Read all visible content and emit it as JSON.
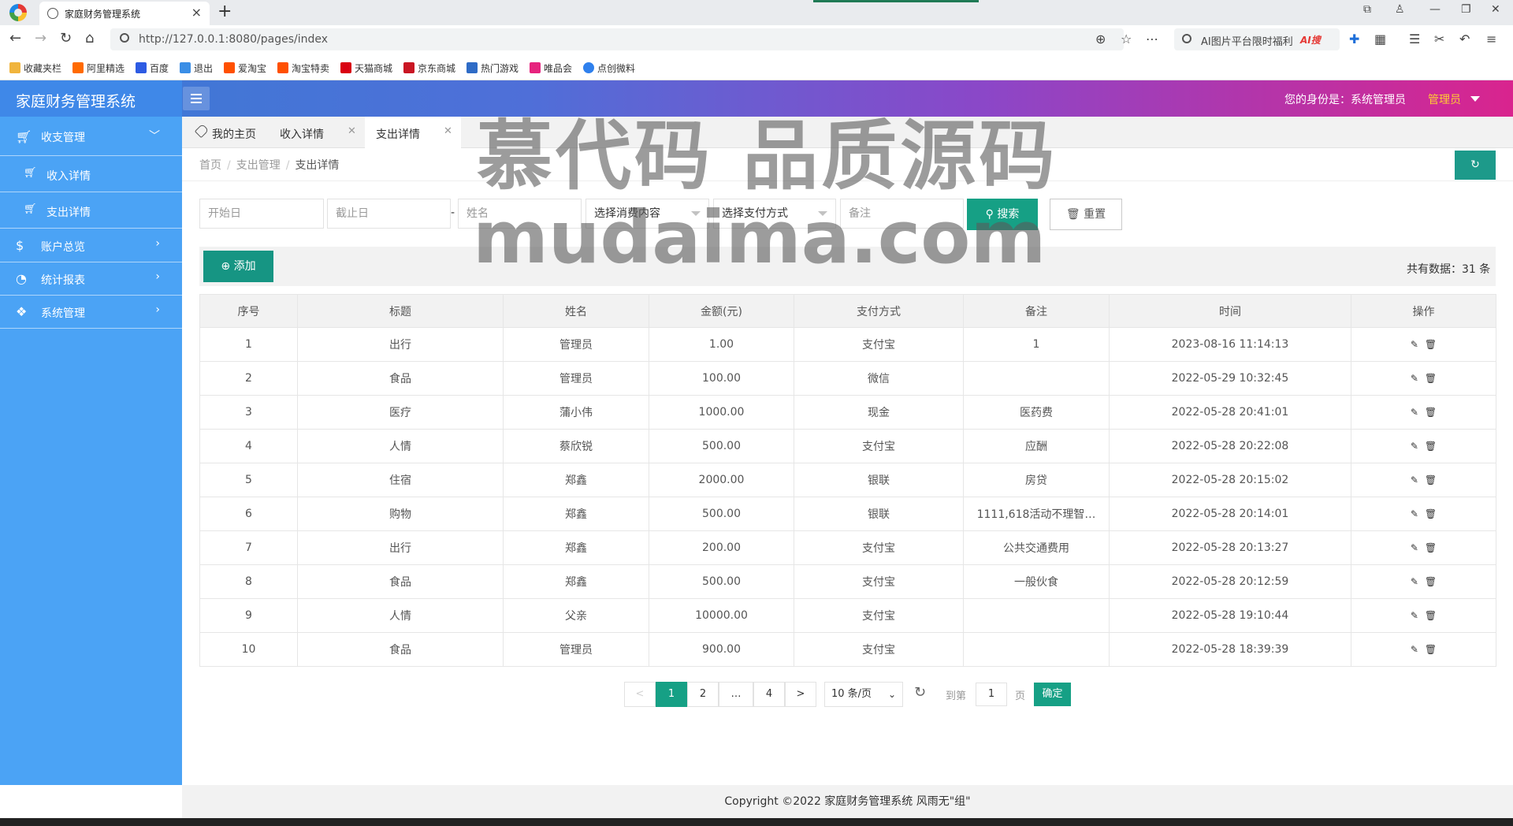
{
  "browser": {
    "tab_title": "家庭财务管理系统",
    "url": "http://127.0.0.1:8080/pages/index",
    "search_text": "AI图片平台限时福利",
    "search_hot": "AI搜",
    "bookmarks": [
      "收藏夹栏",
      "阿里精选",
      "百度",
      "退出",
      "爱淘宝",
      "淘宝特卖",
      "天猫商城",
      "京东商城",
      "热门游戏",
      "唯品会",
      "点创微料"
    ]
  },
  "header": {
    "title": "家庭财务管理系统",
    "identity": "您的身份是：系统管理员",
    "role": "管理员"
  },
  "sidebar": {
    "items": [
      {
        "label": "收支管理"
      },
      {
        "label": "收入详情"
      },
      {
        "label": "支出详情"
      },
      {
        "label": "账户总览"
      },
      {
        "label": "统计报表"
      },
      {
        "label": "系统管理"
      }
    ]
  },
  "tabs": [
    {
      "label": "我的主页"
    },
    {
      "label": "收入详情"
    },
    {
      "label": "支出详情"
    }
  ],
  "breadcrumb": [
    "首页",
    "支出管理",
    "支出详情"
  ],
  "refresh_label": "↻",
  "filters": {
    "start_placeholder": "开始日",
    "end_placeholder": "截止日",
    "name_placeholder": "姓名",
    "consume_select": "选择消费内容",
    "pay_select": "选择支付方式",
    "note_placeholder": "备注",
    "dash": "-",
    "search_label": "搜索",
    "reset_label": "重置"
  },
  "toolbar": {
    "add_label": "添加",
    "total": "共有数据：31 条"
  },
  "table": {
    "headers": [
      "序号",
      "标题",
      "姓名",
      "金额(元)",
      "支付方式",
      "备注",
      "时间",
      "操作"
    ],
    "rows": [
      [
        "1",
        "出行",
        "管理员",
        "1.00",
        "支付宝",
        "1",
        "2023-08-16 11:14:13"
      ],
      [
        "2",
        "食品",
        "管理员",
        "100.00",
        "微信",
        "",
        "2022-05-29 10:32:45"
      ],
      [
        "3",
        "医疗",
        "蒲小伟",
        "1000.00",
        "现金",
        "医药费",
        "2022-05-28 20:41:01"
      ],
      [
        "4",
        "人情",
        "蔡欣锐",
        "500.00",
        "支付宝",
        "应酬",
        "2022-05-28 20:22:08"
      ],
      [
        "5",
        "住宿",
        "郑鑫",
        "2000.00",
        "银联",
        "房贷",
        "2022-05-28 20:15:02"
      ],
      [
        "6",
        "购物",
        "郑鑫",
        "500.00",
        "银联",
        "1111,618活动不理智…",
        "2022-05-28 20:14:01"
      ],
      [
        "7",
        "出行",
        "郑鑫",
        "200.00",
        "支付宝",
        "公共交通费用",
        "2022-05-28 20:13:27"
      ],
      [
        "8",
        "食品",
        "郑鑫",
        "500.00",
        "支付宝",
        "一般伙食",
        "2022-05-28 20:12:59"
      ],
      [
        "9",
        "人情",
        "父亲",
        "10000.00",
        "支付宝",
        "",
        "2022-05-28 19:10:44"
      ],
      [
        "10",
        "食品",
        "管理员",
        "900.00",
        "支付宝",
        "",
        "2022-05-28 18:39:39"
      ]
    ]
  },
  "pager": {
    "prev": "<",
    "pages": [
      "1",
      "2",
      "…",
      "4"
    ],
    "next": ">",
    "size": "10 条/页",
    "goto_label": "到第",
    "goto_value": "1",
    "page_unit": "页",
    "confirm": "确定"
  },
  "footer": "Copyright ©2022 家庭财务管理系统 风雨无\"组\"",
  "watermark": {
    "line1": "慕代码 品质源码",
    "line2": "mudaima.com"
  }
}
